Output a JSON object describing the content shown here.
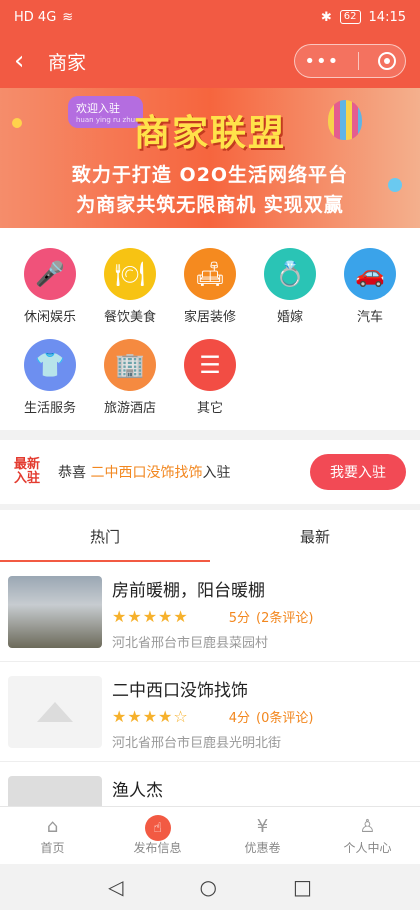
{
  "status_bar": {
    "left_text": "HD 4G",
    "battery": "62",
    "time": "14:15"
  },
  "nav": {
    "title": "商家",
    "back": "‹",
    "more": "•••"
  },
  "banner": {
    "welcome": "欢迎入驻",
    "welcome_sub": "huan ying ru zhu",
    "headline": "商家联盟",
    "line1": "致力于打造 O2O生活网络平台",
    "line2": "为商家共筑无限商机 实现双赢"
  },
  "categories": [
    {
      "label": "休闲娱乐",
      "icon": "microphone-icon",
      "color": "#f0527a"
    },
    {
      "label": "餐饮美食",
      "icon": "food-cloche-icon",
      "color": "#f7c313"
    },
    {
      "label": "家居装修",
      "icon": "sofa-icon",
      "color": "#f58a1f"
    },
    {
      "label": "婚嫁",
      "icon": "rings-icon",
      "color": "#2ac4b5"
    },
    {
      "label": "汽车",
      "icon": "car-icon",
      "color": "#3aa3ea"
    },
    {
      "label": "生活服务",
      "icon": "tshirt-icon",
      "color": "#6d8ff0"
    },
    {
      "label": "旅游酒店",
      "icon": "building-icon",
      "color": "#f58a40"
    },
    {
      "label": "其它",
      "icon": "list-icon",
      "color": "#f24d44"
    }
  ],
  "join": {
    "badge_line1": "最新",
    "badge_line2": "入驻",
    "prefix": "恭喜",
    "shop": "二中西口没饰找饰",
    "suffix": "入驻",
    "button": "我要入驻"
  },
  "tabs": [
    {
      "label": "热门"
    },
    {
      "label": "最新"
    }
  ],
  "listings": [
    {
      "name": "房前暖棚，阳台暖棚",
      "stars": "★★★★★",
      "score": "5分",
      "comments": "(2条评论)",
      "address": "河北省邢台市巨鹿县菜园村"
    },
    {
      "name": "二中西口没饰找饰",
      "stars": "★★★★☆",
      "score": "4分",
      "comments": "(0条评论)",
      "address": "河北省邢台市巨鹿县光明北街"
    },
    {
      "name": "渔人杰",
      "stars": "",
      "score": "",
      "comments": "",
      "address": ""
    }
  ],
  "tabbar": [
    {
      "label": "首页",
      "icon": "home-icon"
    },
    {
      "label": "发布信息",
      "icon": "publish-icon"
    },
    {
      "label": "优惠卷",
      "icon": "coupon-icon"
    },
    {
      "label": "个人中心",
      "icon": "user-icon"
    }
  ],
  "system_nav": {
    "back": "◁",
    "home": "○",
    "recent": "□"
  }
}
